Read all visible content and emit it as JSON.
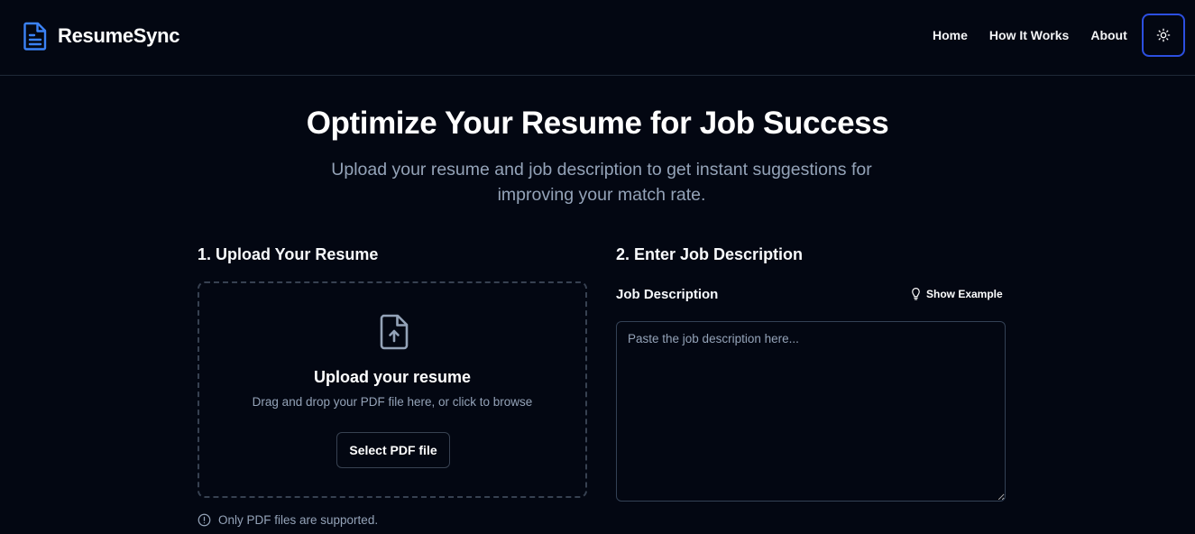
{
  "app": {
    "name": "ResumeSync"
  },
  "nav": {
    "items": [
      {
        "label": "Home"
      },
      {
        "label": "How It Works"
      },
      {
        "label": "About"
      }
    ],
    "theme_toggle_icon": "sun-icon"
  },
  "hero": {
    "title": "Optimize Your Resume for Job Success",
    "subtitle": "Upload your resume and job description to get instant suggestions for improving your match rate."
  },
  "upload": {
    "section_title": "1. Upload Your Resume",
    "heading": "Upload your resume",
    "hint": "Drag and drop your PDF file here, or click to browse",
    "button_label": "Select PDF file",
    "note": "Only PDF files are supported.",
    "icon": "file-upload-icon"
  },
  "job": {
    "section_title": "2. Enter Job Description",
    "field_label": "Job Description",
    "show_example_label": "Show Example",
    "show_example_icon": "lightbulb-icon",
    "placeholder": "Paste the job description here...",
    "value": ""
  },
  "colors": {
    "background": "#030712",
    "accent": "#2c4fe0",
    "brand_icon": "#3b82f6",
    "muted_text": "#94a3b8",
    "border": "#374151"
  }
}
